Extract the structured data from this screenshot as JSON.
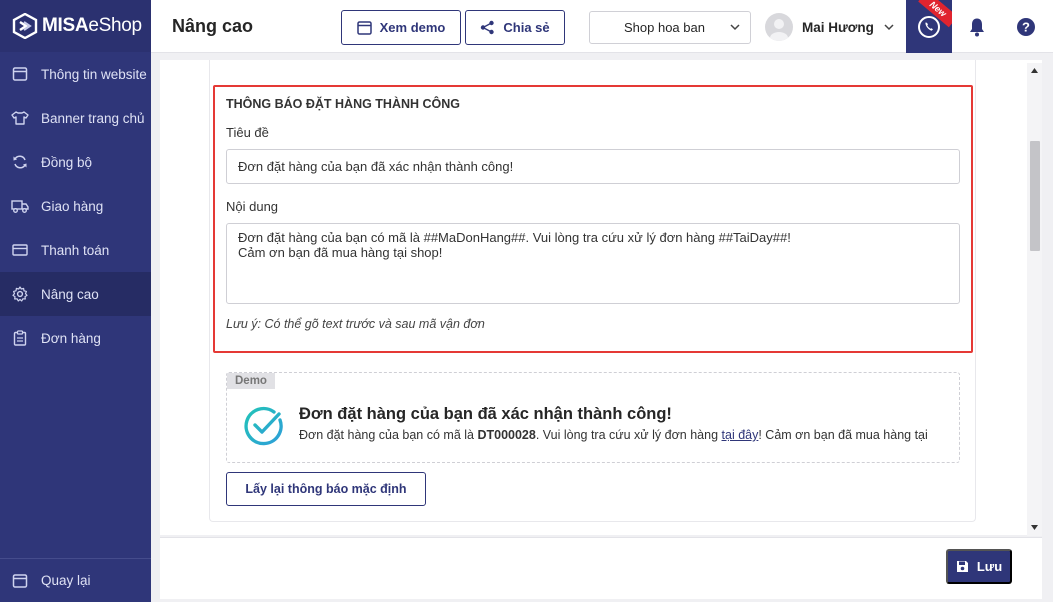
{
  "app": {
    "logo_bold": "MISA",
    "logo_light": "eShop"
  },
  "sidebar": {
    "items": [
      {
        "label": "Thông tin website",
        "icon": "browser-window-icon"
      },
      {
        "label": "Banner trang chủ",
        "icon": "shirt-icon"
      },
      {
        "label": "Đồng bộ",
        "icon": "sync-icon"
      },
      {
        "label": "Giao hàng",
        "icon": "truck-icon"
      },
      {
        "label": "Thanh toán",
        "icon": "card-icon"
      },
      {
        "label": "Nâng cao",
        "icon": "gear-icon"
      },
      {
        "label": "Đơn hàng",
        "icon": "clipboard-icon"
      }
    ],
    "active_index": 5,
    "back_label": "Quay lại"
  },
  "header": {
    "title": "Nâng cao",
    "demo_label": "Xem demo",
    "share_label": "Chia sẻ",
    "shop_name": "Shop hoa ban",
    "user_name": "Mai Hương",
    "new_badge": "New"
  },
  "form": {
    "section_title": "THÔNG BÁO ĐẶT HÀNG THÀNH CÔNG",
    "title_label": "Tiêu đề",
    "title_value": "Đơn đặt hàng của bạn đã xác nhận thành công!",
    "content_label": "Nội dung",
    "content_line1": "Đơn đặt hàng của bạn có mã là ##MaDonHang##. Vui lòng tra cứu xử lý đơn hàng ##TaiDay##!",
    "content_line2": "Cảm ơn bạn đã mua hàng tại shop!",
    "note": "Lưu ý: Có thể gõ text trước và sau mã vận đơn"
  },
  "demo": {
    "tag": "Demo",
    "title": "Đơn đặt hàng của bạn đã xác nhận thành công!",
    "body_prefix": "Đơn đặt hàng của bạn có mã là ",
    "order_code": "DT000028",
    "body_middle": ". Vui lòng tra cứu xử lý đơn hàng ",
    "link_text": "tại đây",
    "body_suffix": "! Cảm ơn bạn đã mua hàng tại"
  },
  "actions": {
    "reset_label": "Lấy lại thông báo mặc định",
    "save_label": "Lưu"
  },
  "colors": {
    "brand": "#2f3679",
    "highlight": "#e53935",
    "success": "#26b5b0"
  }
}
